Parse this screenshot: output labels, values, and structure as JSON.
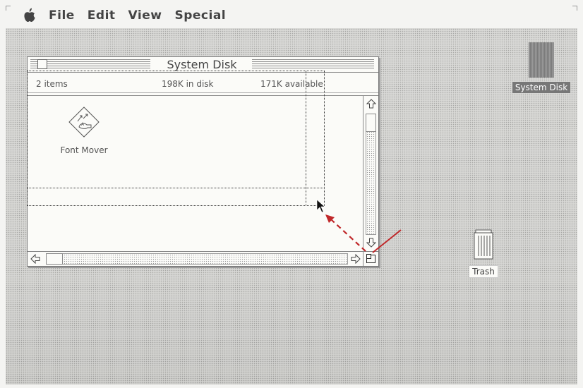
{
  "menubar": {
    "apple_icon": "apple-icon",
    "items": [
      {
        "label": "File"
      },
      {
        "label": "Edit"
      },
      {
        "label": "View"
      },
      {
        "label": "Special"
      }
    ]
  },
  "window": {
    "title": "System Disk",
    "info": {
      "items": "2 items",
      "in_disk": "198K in disk",
      "available": "171K available"
    },
    "icons": [
      {
        "label": "Font Mover",
        "icon": "font-mover-icon"
      }
    ]
  },
  "desktop": {
    "disk_label": "System Disk",
    "trash_label": "Trash"
  },
  "colors": {
    "annotation_arrow": "#c0282a",
    "desktop": "#d8d8d4",
    "window": "#fbfbf8"
  }
}
